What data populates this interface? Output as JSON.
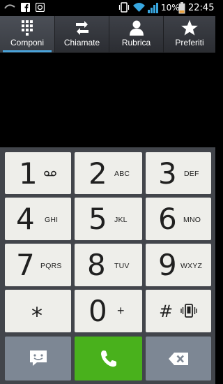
{
  "status": {
    "battery_percent": "10%",
    "time": "22:45",
    "icons": [
      "voicemail-icon",
      "facebook-icon",
      "app-notification-icon",
      "vibrate-icon",
      "wifi-icon",
      "signal-icon",
      "battery-icon"
    ]
  },
  "tabs": [
    {
      "label": "Componi",
      "icon": "dialpad-icon",
      "selected": true
    },
    {
      "label": "Chiamate",
      "icon": "call-log-icon",
      "selected": false
    },
    {
      "label": "Rubrica",
      "icon": "contacts-icon",
      "selected": false
    },
    {
      "label": "Preferiti",
      "icon": "star-icon",
      "selected": false
    }
  ],
  "display": {
    "number": ""
  },
  "keypad": {
    "keys": [
      {
        "digit": "1",
        "sub": ""
      },
      {
        "digit": "2",
        "sub": "ABC"
      },
      {
        "digit": "3",
        "sub": "DEF"
      },
      {
        "digit": "4",
        "sub": "GHI"
      },
      {
        "digit": "5",
        "sub": "JKL"
      },
      {
        "digit": "6",
        "sub": "MNO"
      },
      {
        "digit": "7",
        "sub": "PQRS"
      },
      {
        "digit": "8",
        "sub": "TUV"
      },
      {
        "digit": "9",
        "sub": "WXYZ"
      },
      {
        "digit": "*",
        "sub": ""
      },
      {
        "digit": "0",
        "sub": "+"
      },
      {
        "digit": "#",
        "sub": ""
      }
    ],
    "bottom": {
      "message_icon": "message-icon",
      "call_icon": "call-icon",
      "delete_icon": "backspace-icon"
    }
  },
  "colors": {
    "accent": "#4aa2d8",
    "call_green": "#49b11c",
    "side_key": "#7d8794",
    "key_bg": "#eeeeea"
  }
}
